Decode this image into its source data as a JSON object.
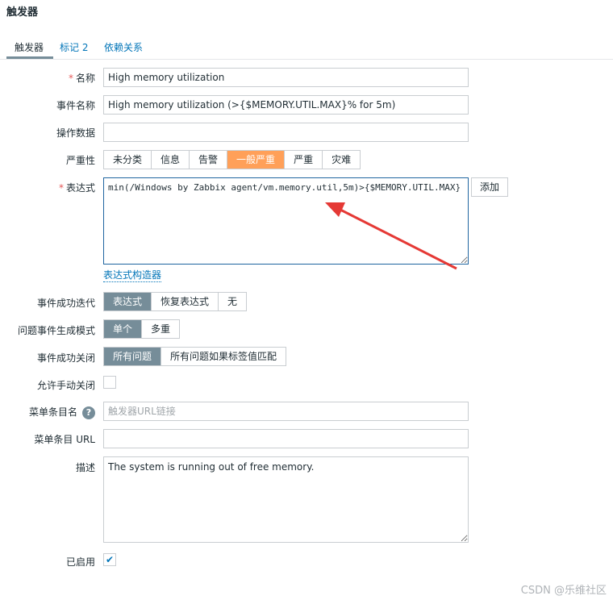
{
  "page": {
    "title": "触发器"
  },
  "tabs": [
    {
      "label": "触发器"
    },
    {
      "label": "标记 2"
    },
    {
      "label": "依赖关系"
    }
  ],
  "form": {
    "required_mark": "*",
    "name": {
      "label": "名称",
      "value": "High memory utilization"
    },
    "event_name": {
      "label": "事件名称",
      "value": "High memory utilization (>{$MEMORY.UTIL.MAX}% for 5m)"
    },
    "opdata": {
      "label": "操作数据",
      "value": ""
    },
    "severity": {
      "label": "严重性",
      "options": [
        "未分类",
        "信息",
        "告警",
        "一般严重",
        "严重",
        "灾难"
      ],
      "selected": "一般严重",
      "selected_color": "#ffa059"
    },
    "expression": {
      "label": "表达式",
      "value": "min(/Windows by Zabbix agent/vm.memory.util,5m)>{$MEMORY.UTIL.MAX}",
      "add_button": "添加",
      "constructor_link": "表达式构造器"
    },
    "ok_event_generation": {
      "label": "事件成功迭代",
      "options": [
        "表达式",
        "恢复表达式",
        "无"
      ],
      "selected": "表达式"
    },
    "problem_event_mode": {
      "label": "问题事件生成模式",
      "options": [
        "单个",
        "多重"
      ],
      "selected": "单个"
    },
    "ok_event_closes": {
      "label": "事件成功关闭",
      "options": [
        "所有问题",
        "所有问题如果标签值匹配"
      ],
      "selected": "所有问题"
    },
    "manual_close": {
      "label": "允许手动关闭",
      "checked": false
    },
    "url_name": {
      "label": "菜单条目名",
      "help_icon": "question-icon",
      "help_glyph": "?",
      "placeholder": "触发器URL链接",
      "value": ""
    },
    "url": {
      "label": "菜单条目 URL",
      "value": ""
    },
    "description": {
      "label": "描述",
      "value": "The system is running out of free memory."
    },
    "enabled": {
      "label": "已启用",
      "checked": true,
      "check_glyph": "✔"
    }
  },
  "colors": {
    "selected_gray": "#768d99",
    "accent_orange": "#ffa059",
    "link_blue": "#0275b8",
    "arrow_red": "#e53935"
  },
  "annotation": {
    "icon": "red-arrow-icon"
  },
  "watermark": "CSDN @乐维社区"
}
